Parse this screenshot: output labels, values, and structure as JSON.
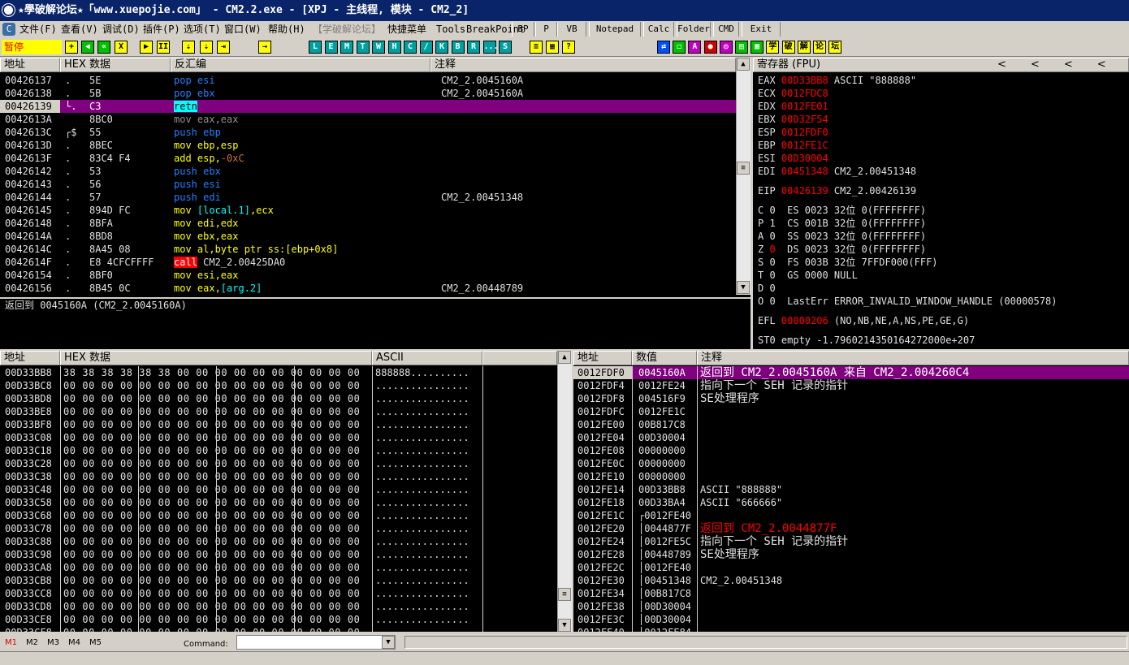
{
  "titlebar": {
    "title": "★學破解论坛★「www.xuepojie.com」 - CM2.2.exe - [XPJ - 主线程, 模块 - CM2_2]"
  },
  "menu": {
    "items": [
      "文件(F)",
      "查看(V)",
      "调试(D)",
      "插件(P)",
      "选项(T)",
      "窗口(W)",
      "帮助(H)",
      "【学破解论坛】",
      "快捷菜单",
      "Tools",
      "BreakPoint"
    ],
    "tools": [
      "BP",
      "P",
      "VB",
      "Notepad",
      "Calc",
      "Folder",
      "CMD",
      "Exit"
    ]
  },
  "toolbar": {
    "status": "暂停",
    "buttons_left": [
      "+",
      "◀",
      "«",
      "X",
      "▶",
      "II",
      "⇣",
      "⇣",
      "⇥",
      "→"
    ],
    "buttons_letters": [
      "L",
      "E",
      "M",
      "T",
      "W",
      "H",
      "C",
      "/",
      "K",
      "B",
      "R",
      "...",
      "S"
    ],
    "buttons_right": [
      "≡",
      "▦",
      "?"
    ],
    "buttons_far": [
      "⇄",
      "◻",
      "A",
      "●",
      "◎",
      "▤",
      "▦",
      "学",
      "破",
      "解",
      "论",
      "坛"
    ]
  },
  "cpu": {
    "headers": {
      "addr": "地址",
      "hex": "HEX 数据",
      "disasm": "反汇编",
      "comment": "注释"
    },
    "rows": [
      {
        "addr": "00426137",
        "mark": ".",
        "hex": "5E",
        "dis": [
          [
            "pop esi",
            "blue"
          ]
        ],
        "comment": "CM2_2.0045160A"
      },
      {
        "addr": "00426138",
        "mark": ".",
        "hex": "5B",
        "dis": [
          [
            "pop ebx",
            "blue"
          ]
        ],
        "comment": "CM2_2.0045160A"
      },
      {
        "addr": "00426139",
        "mark": "└.",
        "hex": "C3",
        "dis": [
          [
            "retn",
            "retn"
          ]
        ],
        "comment": "",
        "selected": true
      },
      {
        "addr": "0042613A",
        "mark": " ",
        "hex": "8BC0",
        "dis": [
          [
            "mov eax,eax",
            "gray"
          ]
        ],
        "comment": ""
      },
      {
        "addr": "0042613C",
        "mark": "┌$",
        "hex": "55",
        "dis": [
          [
            "push ebp",
            "blue"
          ]
        ],
        "comment": ""
      },
      {
        "addr": "0042613D",
        "mark": ".",
        "hex": "8BEC",
        "dis": [
          [
            "mov ",
            "yellow"
          ],
          [
            "ebp,esp",
            "yellow"
          ]
        ],
        "comment": ""
      },
      {
        "addr": "0042613F",
        "mark": ".",
        "hex": "83C4 F4",
        "dis": [
          [
            "add esp,",
            "yellow"
          ],
          [
            "-0xC",
            "cyanish"
          ]
        ],
        "comment": ""
      },
      {
        "addr": "00426142",
        "mark": ".",
        "hex": "53",
        "dis": [
          [
            "push ebx",
            "blue"
          ]
        ],
        "comment": ""
      },
      {
        "addr": "00426143",
        "mark": ".",
        "hex": "56",
        "dis": [
          [
            "push esi",
            "blue"
          ]
        ],
        "comment": ""
      },
      {
        "addr": "00426144",
        "mark": ".",
        "hex": "57",
        "dis": [
          [
            "push edi",
            "blue"
          ]
        ],
        "comment": "CM2_2.00451348"
      },
      {
        "addr": "00426145",
        "mark": ".",
        "hex": "894D FC",
        "dis": [
          [
            "mov ",
            "yellow"
          ],
          [
            "[local.1]",
            "cyan"
          ],
          [
            ",ecx",
            "yellow"
          ]
        ],
        "comment": ""
      },
      {
        "addr": "00426148",
        "mark": ".",
        "hex": "8BFA",
        "dis": [
          [
            "mov edi,edx",
            "yellow"
          ]
        ],
        "comment": ""
      },
      {
        "addr": "0042614A",
        "mark": ".",
        "hex": "8BD8",
        "dis": [
          [
            "mov ebx,eax",
            "yellow"
          ]
        ],
        "comment": ""
      },
      {
        "addr": "0042614C",
        "mark": ".",
        "hex": "8A45 08",
        "dis": [
          [
            "mov al,byte ptr ss:[ebp+0x8]",
            "yellow"
          ]
        ],
        "comment": ""
      },
      {
        "addr": "0042614F",
        "mark": ".",
        "hex": "E8 4CFCFFFF",
        "dis": [
          [
            "call",
            "call"
          ],
          [
            " CM2_2.00425DA0",
            "white"
          ]
        ],
        "comment": ""
      },
      {
        "addr": "00426154",
        "mark": ".",
        "hex": "8BF0",
        "dis": [
          [
            "mov esi,eax",
            "yellow"
          ]
        ],
        "comment": ""
      },
      {
        "addr": "00426156",
        "mark": ".",
        "hex": "8B45 0C",
        "dis": [
          [
            "mov eax,",
            "yellow"
          ],
          [
            "[arg.2]",
            "cyan"
          ]
        ],
        "comment": "CM2_2.00448789"
      }
    ],
    "info": "返回到 0045160A (CM2_2.0045160A)"
  },
  "registers": {
    "header": "寄存器 (FPU)",
    "nav": [
      "<",
      "<",
      "<",
      "<"
    ],
    "lines": [
      [
        [
          "EAX ",
          ""
        ],
        [
          "00D33BB8",
          "red"
        ],
        [
          " ASCII \"888888\"",
          ""
        ]
      ],
      [
        [
          "ECX ",
          ""
        ],
        [
          "0012FDC8",
          "red"
        ]
      ],
      [
        [
          "EDX ",
          ""
        ],
        [
          "0012FE01",
          "red"
        ]
      ],
      [
        [
          "EBX ",
          ""
        ],
        [
          "00D32F54",
          "red"
        ]
      ],
      [
        [
          "ESP ",
          ""
        ],
        [
          "0012FDF0",
          "red"
        ]
      ],
      [
        [
          "EBP ",
          ""
        ],
        [
          "0012FE1C",
          "red"
        ]
      ],
      [
        [
          "ESI ",
          ""
        ],
        [
          "00D30004",
          "red"
        ]
      ],
      [
        [
          "EDI ",
          ""
        ],
        [
          "00451348",
          "red"
        ],
        [
          " CM2_2.00451348",
          ""
        ]
      ],
      [
        [
          "",
          ""
        ]
      ],
      [
        [
          "EIP ",
          ""
        ],
        [
          "00426139",
          "red"
        ],
        [
          " CM2_2.00426139",
          ""
        ]
      ],
      [
        [
          "",
          ""
        ]
      ],
      [
        [
          "C 0  ES 0023 32位 0(FFFFFFFF)",
          ""
        ]
      ],
      [
        [
          "P 1  CS 001B 32位 0(FFFFFFFF)",
          ""
        ]
      ],
      [
        [
          "A 0  SS 0023 32位 0(FFFFFFFF)",
          ""
        ]
      ],
      [
        [
          "Z ",
          ""
        ],
        [
          "0",
          "red"
        ],
        [
          "  DS 0023 32位 0(FFFFFFFF)",
          ""
        ]
      ],
      [
        [
          "S 0  FS 003B 32位 7FFDF000(FFF)",
          ""
        ]
      ],
      [
        [
          "T 0  GS 0000 NULL",
          ""
        ]
      ],
      [
        [
          "D 0",
          ""
        ]
      ],
      [
        [
          "O 0  LastErr ERROR_INVALID_WINDOW_HANDLE (00000578)",
          ""
        ]
      ],
      [
        [
          "",
          ""
        ]
      ],
      [
        [
          "EFL ",
          ""
        ],
        [
          "00000206",
          "red"
        ],
        [
          " (NO,NB,NE,A,NS,PE,GE,G)",
          ""
        ]
      ],
      [
        [
          "",
          ""
        ]
      ],
      [
        [
          "ST0 empty -1.7960214350164272000e+207",
          ""
        ]
      ]
    ]
  },
  "dump": {
    "headers": {
      "addr": "地址",
      "hex": "HEX 数据",
      "ascii": "ASCII"
    },
    "rows": [
      {
        "addr": "00D33BB8",
        "hex": "38 38 38 38 38 38 00 00 00 00 00 00 00 00 00 00",
        "ascii": "888888.........."
      },
      {
        "addr": "00D33BC8",
        "hex": "00 00 00 00 00 00 00 00 00 00 00 00 00 00 00 00",
        "ascii": "................"
      },
      {
        "addr": "00D33BD8",
        "hex": "00 00 00 00 00 00 00 00 00 00 00 00 00 00 00 00",
        "ascii": "................"
      },
      {
        "addr": "00D33BE8",
        "hex": "00 00 00 00 00 00 00 00 00 00 00 00 00 00 00 00",
        "ascii": "................"
      },
      {
        "addr": "00D33BF8",
        "hex": "00 00 00 00 00 00 00 00 00 00 00 00 00 00 00 00",
        "ascii": "................"
      },
      {
        "addr": "00D33C08",
        "hex": "00 00 00 00 00 00 00 00 00 00 00 00 00 00 00 00",
        "ascii": "................"
      },
      {
        "addr": "00D33C18",
        "hex": "00 00 00 00 00 00 00 00 00 00 00 00 00 00 00 00",
        "ascii": "................"
      },
      {
        "addr": "00D33C28",
        "hex": "00 00 00 00 00 00 00 00 00 00 00 00 00 00 00 00",
        "ascii": "................"
      },
      {
        "addr": "00D33C38",
        "hex": "00 00 00 00 00 00 00 00 00 00 00 00 00 00 00 00",
        "ascii": "................"
      },
      {
        "addr": "00D33C48",
        "hex": "00 00 00 00 00 00 00 00 00 00 00 00 00 00 00 00",
        "ascii": "................"
      },
      {
        "addr": "00D33C58",
        "hex": "00 00 00 00 00 00 00 00 00 00 00 00 00 00 00 00",
        "ascii": "................"
      },
      {
        "addr": "00D33C68",
        "hex": "00 00 00 00 00 00 00 00 00 00 00 00 00 00 00 00",
        "ascii": "................"
      },
      {
        "addr": "00D33C78",
        "hex": "00 00 00 00 00 00 00 00 00 00 00 00 00 00 00 00",
        "ascii": "................"
      },
      {
        "addr": "00D33C88",
        "hex": "00 00 00 00 00 00 00 00 00 00 00 00 00 00 00 00",
        "ascii": "................"
      },
      {
        "addr": "00D33C98",
        "hex": "00 00 00 00 00 00 00 00 00 00 00 00 00 00 00 00",
        "ascii": "................"
      },
      {
        "addr": "00D33CA8",
        "hex": "00 00 00 00 00 00 00 00 00 00 00 00 00 00 00 00",
        "ascii": "................"
      },
      {
        "addr": "00D33CB8",
        "hex": "00 00 00 00 00 00 00 00 00 00 00 00 00 00 00 00",
        "ascii": "................"
      },
      {
        "addr": "00D33CC8",
        "hex": "00 00 00 00 00 00 00 00 00 00 00 00 00 00 00 00",
        "ascii": "................"
      },
      {
        "addr": "00D33CD8",
        "hex": "00 00 00 00 00 00 00 00 00 00 00 00 00 00 00 00",
        "ascii": "................"
      },
      {
        "addr": "00D33CE8",
        "hex": "00 00 00 00 00 00 00 00 00 00 00 00 00 00 00 00",
        "ascii": "................"
      },
      {
        "addr": "00D33CF8",
        "hex": "00 00 00 00 00 00 00 00 00 00 00 00 00 00 00 00",
        "ascii": "................"
      }
    ]
  },
  "stack": {
    "headers": {
      "addr": "地址",
      "val": "数值",
      "comment": "注释"
    },
    "rows": [
      {
        "addr": "0012FDF0",
        "val": "0045160A",
        "comment": "返回到 CM2_2.0045160A 来自 CM2_2.004260C4",
        "red": true,
        "selected": true
      },
      {
        "addr": "0012FDF4",
        "val": "0012FE24",
        "comment": "指向下一个 SEH 记录的指针"
      },
      {
        "addr": "0012FDF8",
        "val": "004516F9",
        "comment": "SE处理程序"
      },
      {
        "addr": "0012FDFC",
        "val": "0012FE1C",
        "comment": ""
      },
      {
        "addr": "0012FE00",
        "val": "00B817C8",
        "comment": ""
      },
      {
        "addr": "0012FE04",
        "val": "00D30004",
        "comment": ""
      },
      {
        "addr": "0012FE08",
        "val": "00000000",
        "comment": ""
      },
      {
        "addr": "0012FE0C",
        "val": "00000000",
        "comment": ""
      },
      {
        "addr": "0012FE10",
        "val": "00000000",
        "comment": ""
      },
      {
        "addr": "0012FE14",
        "val": "00D33BB8",
        "comment": "ASCII \"888888\""
      },
      {
        "addr": "0012FE18",
        "val": "00D33BA4",
        "comment": "ASCII \"666666\""
      },
      {
        "addr": "0012FE1C",
        "val": "┌0012FE40",
        "comment": ""
      },
      {
        "addr": "0012FE20",
        "val": "│0044877F",
        "comment": "返回到 CM2_2.0044877F",
        "red": true
      },
      {
        "addr": "0012FE24",
        "val": "│0012FE5C",
        "comment": "指向下一个 SEH 记录的指针"
      },
      {
        "addr": "0012FE28",
        "val": "│00448789",
        "comment": "SE处理程序"
      },
      {
        "addr": "0012FE2C",
        "val": "│0012FE40",
        "comment": ""
      },
      {
        "addr": "0012FE30",
        "val": "│00451348",
        "comment": "CM2_2.00451348"
      },
      {
        "addr": "0012FE34",
        "val": "│00B817C8",
        "comment": ""
      },
      {
        "addr": "0012FE38",
        "val": "│00D30004",
        "comment": ""
      },
      {
        "addr": "0012FE3C",
        "val": "│00D30004",
        "comment": ""
      },
      {
        "addr": "0012FE40",
        "val": "└0012FE84",
        "comment": ""
      }
    ]
  },
  "bottom": {
    "tabs": [
      "M1",
      "M2",
      "M3",
      "M4",
      "M5"
    ],
    "command_label": "Command:",
    "command_value": ""
  },
  "colors": {
    "selection": "#800080",
    "accent_red": "#ff0000",
    "keyword_blue": "#2080ff",
    "operand_yellow": "#ffff00"
  }
}
